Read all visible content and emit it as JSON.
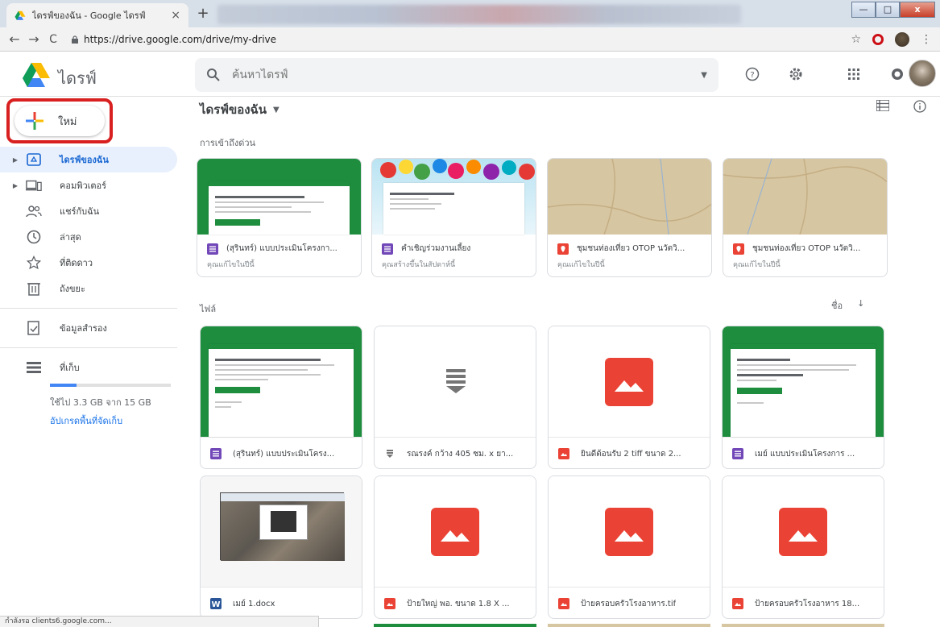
{
  "browser": {
    "tab_title": "ไดรฟ์ของฉัน - Google ไดรฟ์",
    "tab_close": "×",
    "new_tab": "+",
    "url": "https://drive.google.com/drive/my-drive",
    "back": "←",
    "forward": "→",
    "reload": "C",
    "star": "☆",
    "menu": "⋮",
    "window_minimize": "—",
    "window_maximize": "□",
    "window_close": "x"
  },
  "header": {
    "app_title": "ไดรฟ์",
    "search_placeholder": "ค้นหาไดรฟ์"
  },
  "sidebar": {
    "new_button_label": "ใหม่",
    "items": [
      {
        "label": "ไดรฟ์ของฉัน",
        "icon": "my-drive-icon",
        "active": true,
        "expandable": true
      },
      {
        "label": "คอมพิวเตอร์",
        "icon": "computer-icon",
        "active": false,
        "expandable": true
      },
      {
        "label": "แชร์กับฉัน",
        "icon": "shared-icon",
        "active": false,
        "expandable": false
      },
      {
        "label": "ล่าสุด",
        "icon": "clock-icon",
        "active": false,
        "expandable": false
      },
      {
        "label": "ที่ติดดาว",
        "icon": "star-icon",
        "active": false,
        "expandable": false
      },
      {
        "label": "ถังขยะ",
        "icon": "trash-icon",
        "active": false,
        "expandable": false
      }
    ],
    "backup_label": "ข้อมูลสำรอง",
    "storage_label": "ที่เก็บ",
    "storage_used_text": "ใช้ไป 3.3 GB จาก 15 GB",
    "storage_fraction": 0.22,
    "upgrade_label": "อัปเกรดพื้นที่จัดเก็บ"
  },
  "main": {
    "title": "ไดรฟ์ของฉัน",
    "quick_access_label": "การเข้าถึงด่วน",
    "files_label": "ไฟล์",
    "sort_label": "ชื่อ",
    "quick_access": [
      {
        "name": "(สุรินทร์) แบบประเมินโครงกา...",
        "sub": "คุณแก้ไขในปีนี้",
        "type": "form"
      },
      {
        "name": "คำเชิญร่วมงานเลี้ยง",
        "sub": "คุณสร้างขึ้นในสัปดาห์นี้",
        "type": "form"
      },
      {
        "name": "ชุมชนท่องเที่ยว OTOP นวัตวิ...",
        "sub": "คุณแก้ไขในปีนี้",
        "type": "map"
      },
      {
        "name": "ชุมชนท่องเที่ยว OTOP นวัตวิ...",
        "sub": "คุณแก้ไขในปีนี้",
        "type": "map"
      }
    ],
    "files_row1": [
      {
        "name": "(สุรินทร์) แบบประเมินโครง...",
        "type": "form"
      },
      {
        "name": "รณรงค์ กว้าง 405 ซม. x ยา...",
        "type": "file"
      },
      {
        "name": "ยินดีต้อนรับ 2 tiff ขนาด 2...",
        "type": "image"
      },
      {
        "name": "เมย์ แบบประเมินโครงการ ...",
        "type": "form"
      }
    ],
    "files_row2": [
      {
        "name": "เมย์ 1.docx",
        "type": "word"
      },
      {
        "name": "ป้ายใหญ่ พอ. ขนาด 1.8 X ...",
        "type": "image"
      },
      {
        "name": "ป้ายครอบครัวโรงอาหาร.tif",
        "type": "image"
      },
      {
        "name": "ป้ายครอบครัวโรงอาหาร 18...",
        "type": "image"
      }
    ]
  },
  "status_bar": "กำลังรอ clients6.google.com...",
  "colors": {
    "accent_blue": "#1a73e8",
    "active_bg": "#e8f0fe",
    "form_purple": "#7248b9",
    "map_red": "#ea4335",
    "form_green": "#1e8e3e",
    "highlight_red": "#d92020"
  }
}
